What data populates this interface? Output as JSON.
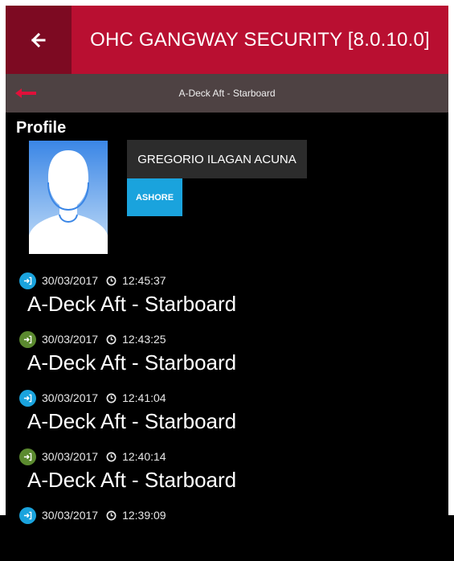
{
  "header": {
    "title": "OHC GANGWAY SECURITY [8.0.10.0]"
  },
  "subheader": {
    "title": "A-Deck Aft - Starboard"
  },
  "profile": {
    "label": "Profile",
    "name": "GREGORIO ILAGAN ACUNA",
    "status": "ASHORE"
  },
  "colors": {
    "header": "#b90f31",
    "back_button": "#7d0a22",
    "subheader": "#4e4243",
    "status_badge": "#1aa3dd",
    "direction_blue": "#1aa3dd",
    "direction_green": "#5b8a2f"
  },
  "log": [
    {
      "direction_color": "#1aa3dd",
      "icon": "sign-in-icon",
      "date": "30/03/2017",
      "time": "12:45:37",
      "location": "A-Deck Aft - Starboard"
    },
    {
      "direction_color": "#5b8a2f",
      "icon": "sign-in-icon",
      "date": "30/03/2017",
      "time": "12:43:25",
      "location": "A-Deck Aft - Starboard"
    },
    {
      "direction_color": "#1aa3dd",
      "icon": "sign-in-icon",
      "date": "30/03/2017",
      "time": "12:41:04",
      "location": "A-Deck Aft - Starboard"
    },
    {
      "direction_color": "#5b8a2f",
      "icon": "sign-in-icon",
      "date": "30/03/2017",
      "time": "12:40:14",
      "location": "A-Deck Aft - Starboard"
    },
    {
      "direction_color": "#1aa3dd",
      "icon": "sign-in-icon",
      "date": "30/03/2017",
      "time": "12:39:09",
      "location": ""
    }
  ]
}
